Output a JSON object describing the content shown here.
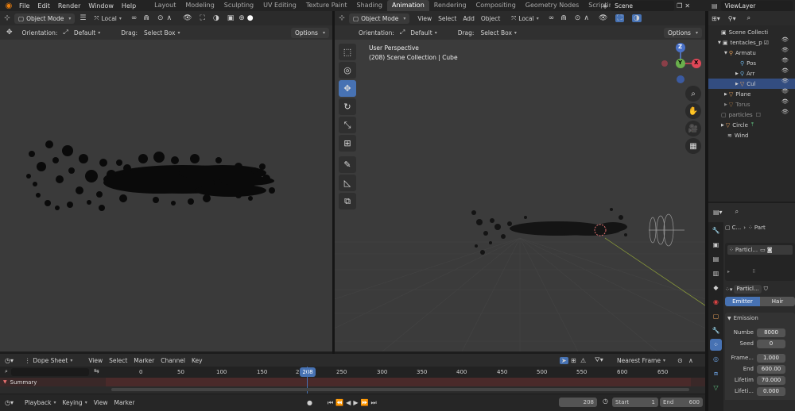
{
  "topbar": {
    "menus": [
      "File",
      "Edit",
      "Render",
      "Window",
      "Help"
    ],
    "workspaces": [
      "Layout",
      "Modeling",
      "Sculpting",
      "UV Editing",
      "Texture Paint",
      "Shading",
      "Animation",
      "Rendering",
      "Compositing",
      "Geometry Nodes",
      "Scripting"
    ],
    "active_workspace": "Animation",
    "scene": "Scene",
    "view_layer": "ViewLayer"
  },
  "left_viewport": {
    "mode": "Object Mode",
    "pivot": "Local",
    "orientation_label": "Orientation:",
    "orientation_value": "Default",
    "drag_label": "Drag:",
    "drag_value": "Select Box",
    "options": "Options"
  },
  "right_viewport": {
    "mode": "Object Mode",
    "menus": [
      "View",
      "Select",
      "Add",
      "Object"
    ],
    "pivot": "Local",
    "orientation_label": "Orientation:",
    "orientation_value": "Default",
    "drag_label": "Drag:",
    "drag_value": "Select Box",
    "options": "Options",
    "overlay_line1": "User Perspective",
    "overlay_line2": "(208) Scene Collection | Cube",
    "gizmo": {
      "z": "Z",
      "y": "Y",
      "x": "X"
    }
  },
  "outliner": {
    "rows": [
      {
        "label": "Scene Collecti",
        "indent": 0
      },
      {
        "label": "tentacles_p",
        "indent": 1
      },
      {
        "label": "Armatu",
        "indent": 2
      },
      {
        "label": "Pos",
        "indent": 3
      },
      {
        "label": "Arr",
        "indent": 3
      },
      {
        "label": "Cul",
        "indent": 3
      },
      {
        "label": "Plane",
        "indent": 2
      },
      {
        "label": "Torus",
        "indent": 2
      },
      {
        "label": "particles",
        "indent": 1
      },
      {
        "label": "Circle",
        "indent": 1
      },
      {
        "label": "Wind",
        "indent": 1
      }
    ]
  },
  "properties": {
    "breadcrumb_a": "C...",
    "breadcrumb_b": "Part",
    "slot_name": "Particl...",
    "settings_name": "Particl...",
    "type_emitter": "Emitter",
    "type_hair": "Hair",
    "panel_title": "Emission",
    "fields": [
      {
        "label": "Numbe",
        "value": "8000"
      },
      {
        "label": "Seed",
        "value": "0"
      },
      {
        "label": "Frame...",
        "value": "1.000"
      },
      {
        "label": "End",
        "value": "600.00"
      },
      {
        "label": "Lifetim",
        "value": "70.000"
      },
      {
        "label": "Lifeti...",
        "value": "0.000"
      }
    ]
  },
  "dopesheet": {
    "mode": "Dope Sheet",
    "menus": [
      "View",
      "Select",
      "Marker",
      "Channel",
      "Key"
    ],
    "interpolation": "Nearest Frame",
    "ticks": [
      "0",
      "50",
      "100",
      "150",
      "200",
      "250",
      "300",
      "350",
      "400",
      "450",
      "500",
      "550",
      "600",
      "650"
    ],
    "current_frame": "208",
    "summary": "Summary"
  },
  "timeline": {
    "menus": [
      "Playback",
      "Keying",
      "View",
      "Marker"
    ],
    "frame": "208",
    "start_label": "Start",
    "start": "1",
    "end_label": "End",
    "end": "600"
  },
  "colors": {
    "accent": "#4772b3",
    "viewport_bg": "#3a3a3a",
    "header_bg": "#2b2b2b",
    "summary_bg": "#502020"
  }
}
